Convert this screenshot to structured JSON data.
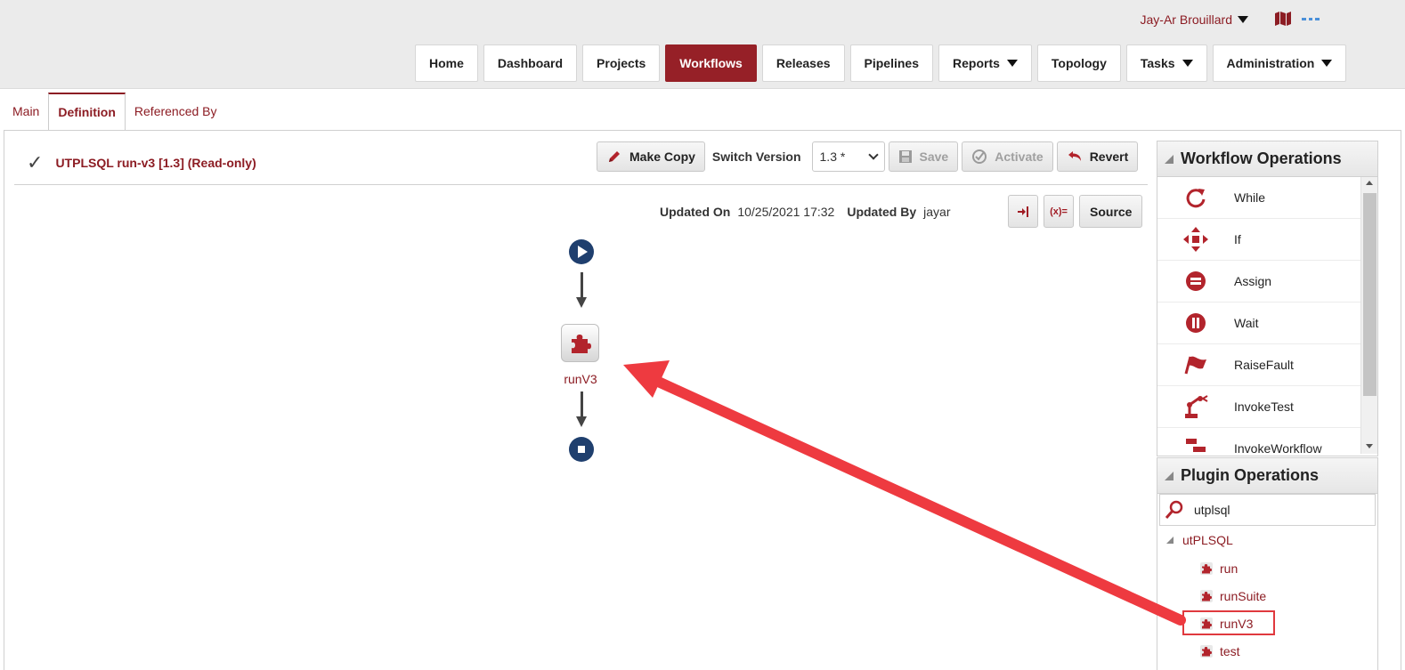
{
  "header": {
    "user_name": "Jay-Ar Brouillard",
    "icons": [
      "map-icon",
      "more-icon"
    ]
  },
  "nav": {
    "items": [
      {
        "label": "Home",
        "active": false,
        "dropdown": false
      },
      {
        "label": "Dashboard",
        "active": false,
        "dropdown": false
      },
      {
        "label": "Projects",
        "active": false,
        "dropdown": false
      },
      {
        "label": "Workflows",
        "active": true,
        "dropdown": false
      },
      {
        "label": "Releases",
        "active": false,
        "dropdown": false
      },
      {
        "label": "Pipelines",
        "active": false,
        "dropdown": false
      },
      {
        "label": "Reports",
        "active": false,
        "dropdown": true
      },
      {
        "label": "Topology",
        "active": false,
        "dropdown": false
      },
      {
        "label": "Tasks",
        "active": false,
        "dropdown": true
      },
      {
        "label": "Administration",
        "active": false,
        "dropdown": true
      }
    ]
  },
  "tabs": [
    {
      "label": "Main",
      "active": false
    },
    {
      "label": "Definition",
      "active": true
    },
    {
      "label": "Referenced By",
      "active": false
    }
  ],
  "workflow": {
    "title": "UTPLSQL run-v3 [1.3] (Read-only)",
    "toolbar": {
      "make_copy": "Make Copy",
      "switch_version_label": "Switch Version",
      "version_value": "1.3 *",
      "save": "Save",
      "activate": "Activate",
      "revert": "Revert"
    },
    "updated_on_label": "Updated On",
    "updated_on_value": "10/25/2021 17:32",
    "updated_by_label": "Updated By",
    "updated_by_value": "jayar",
    "source_button": "Source",
    "variables_button": "(x)=",
    "node_label": "runV3"
  },
  "workflow_operations": {
    "title": "Workflow Operations",
    "items": [
      {
        "label": "While",
        "icon": "loop-icon"
      },
      {
        "label": "If",
        "icon": "branch-icon"
      },
      {
        "label": "Assign",
        "icon": "assign-icon"
      },
      {
        "label": "Wait",
        "icon": "pause-icon"
      },
      {
        "label": "RaiseFault",
        "icon": "flag-icon"
      },
      {
        "label": "InvokeTest",
        "icon": "robot-arm-icon"
      },
      {
        "label": "InvokeWorkflow",
        "icon": "workflow-icon"
      }
    ]
  },
  "plugin_operations": {
    "title": "Plugin Operations",
    "search_value": "utplsql",
    "group": "utPLSQL",
    "items": [
      {
        "label": "run",
        "highlighted": false
      },
      {
        "label": "runSuite",
        "highlighted": false
      },
      {
        "label": "runV3",
        "highlighted": true
      },
      {
        "label": "test",
        "highlighted": false
      }
    ]
  },
  "colors": {
    "brand": "#962027",
    "link": "#8c1c23",
    "node_blue": "#1f3f6e",
    "annotation_arrow": "#ee3a40"
  }
}
